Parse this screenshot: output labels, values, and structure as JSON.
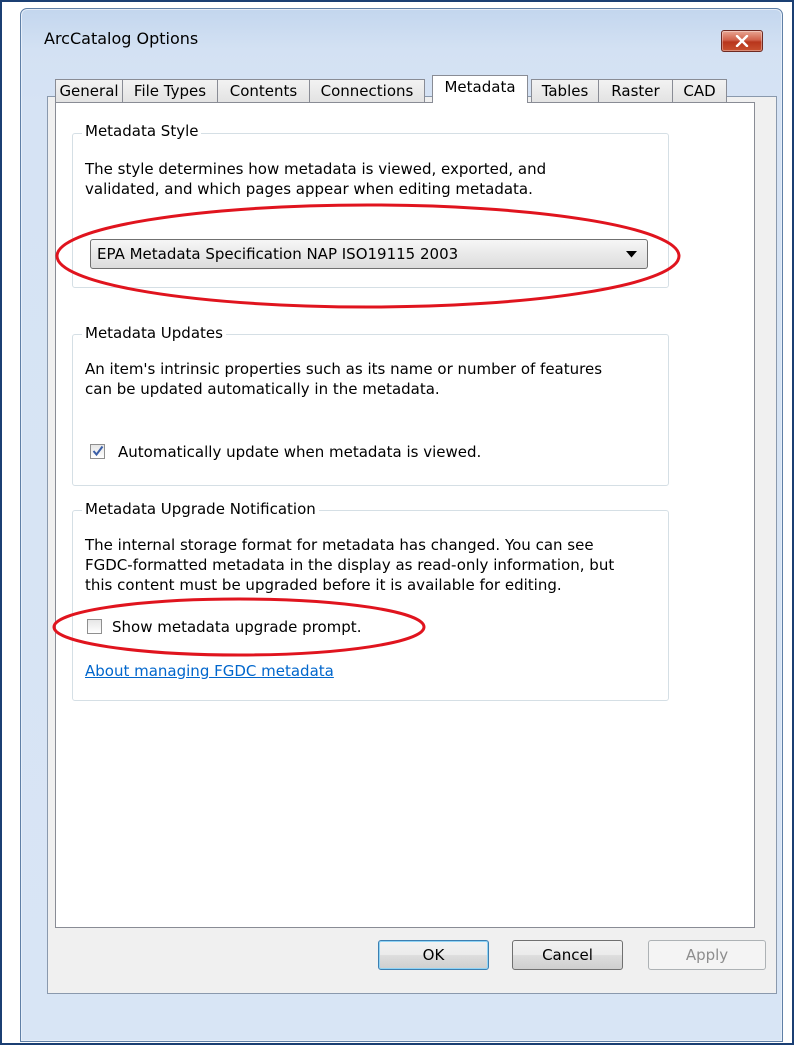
{
  "window": {
    "title": "ArcCatalog Options"
  },
  "tabs": [
    {
      "label": "General"
    },
    {
      "label": "File Types"
    },
    {
      "label": "Contents"
    },
    {
      "label": "Connections"
    },
    {
      "label": "Metadata"
    },
    {
      "label": "Tables"
    },
    {
      "label": "Raster"
    },
    {
      "label": "CAD"
    }
  ],
  "active_tab": "Metadata",
  "metadata_style": {
    "title": "Metadata Style",
    "description_line1": "The style determines how metadata is viewed, exported, and",
    "description_line2": "validated, and which pages appear when editing metadata.",
    "selected_style": "EPA Metadata Specification NAP ISO19115 2003"
  },
  "metadata_updates": {
    "title": "Metadata Updates",
    "description_line1": "An item's intrinsic properties such as its name or number of features",
    "description_line2": "can be updated automatically in the metadata.",
    "checkbox_label": "Automatically update when metadata is viewed.",
    "checked": true
  },
  "upgrade_notification": {
    "title": "Metadata Upgrade Notification",
    "description_line1": "The internal storage format for metadata has changed. You can see",
    "description_line2": "FGDC-formatted metadata in the display as read-only information, but",
    "description_line3": "this content must be upgraded before it is available for editing.",
    "checkbox_label": "Show metadata upgrade prompt.",
    "checked": false,
    "link_text": "About managing FGDC metadata"
  },
  "buttons": {
    "ok": "OK",
    "cancel": "Cancel",
    "apply": "Apply"
  },
  "colors": {
    "annotation_red": "#e0141e",
    "link_blue": "#0066cc",
    "title_bar": "#c3d6ee"
  },
  "icons": {
    "close": "close-icon",
    "dropdown": "dropdown-arrow-icon",
    "checkmark": "checkmark-icon"
  }
}
